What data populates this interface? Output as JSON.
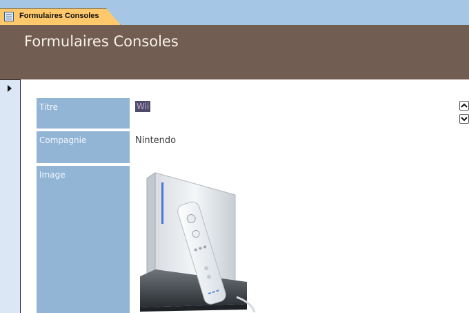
{
  "tab": {
    "label": "Formulaires Consoles",
    "icon": "form-icon"
  },
  "header": {
    "title": "Formulaires Consoles"
  },
  "record": {
    "selector_icon": "record-pointer-icon"
  },
  "fields": {
    "titre": {
      "label": "Titre",
      "value": "Wii"
    },
    "compagnie": {
      "label": "Compagnie",
      "value": "Nintendo"
    },
    "image": {
      "label": "Image"
    }
  },
  "controls": {
    "scroll_up_icon": "chevron-up-icon",
    "scroll_down_icon": "chevron-down-icon"
  },
  "colors": {
    "tabstrip": "#a6c6e6",
    "tab": "#ffc86a",
    "header": "#725d52",
    "label_bg": "#92b5d6"
  }
}
